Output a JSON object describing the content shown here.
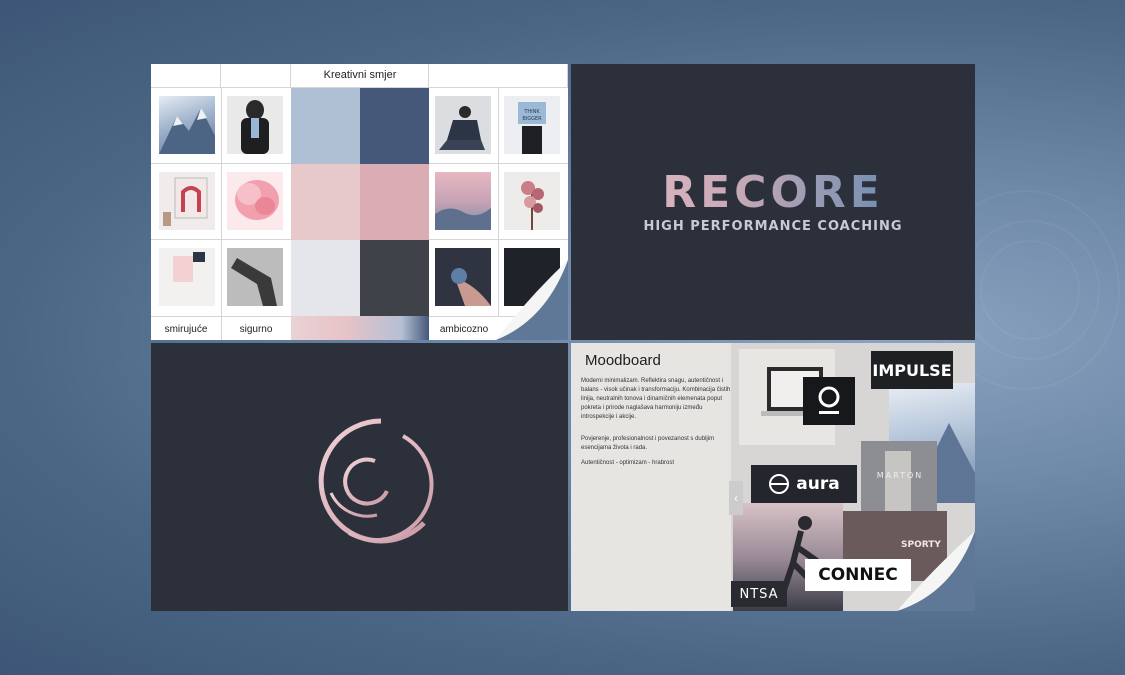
{
  "grid_panel": {
    "header": "Kreativni smjer",
    "labels": [
      "smirujuće",
      "sigurno",
      "ambicozno"
    ],
    "palette": [
      "#b0c0d4",
      "#45587a",
      "#e8c9cb",
      "#d9adb3",
      "#e4e6ec",
      "#3f4248"
    ]
  },
  "logo_panel": {
    "brand_word": "RECORE",
    "tagline": "HIGH PERFORMANCE COACHING"
  },
  "moodboard": {
    "title": "Moodboard",
    "paragraph1": "Moderni minimalizam. Reflektira snagu, autentičnost i balans - visok učinak i transformaciju. Kombinacija čistih linija, neutralnih tonova i dinamičnih elemenata poput pokreta i prirode naglašava harmoniju između introspekcije i akcije.",
    "paragraph2": "Povjerenje, profesionalnost i povezanost s dubljim esencijama života i rada.",
    "paragraph3": "Autentičnost - optimizam - hrabrost",
    "logos": {
      "impulse": "IMPULSE",
      "aura": "aura",
      "marton": "MARTON",
      "connect": "CONNEC",
      "ntsa": "NTSA",
      "sporty": "SPORTY",
      "think": "THINK BIGGER"
    }
  }
}
